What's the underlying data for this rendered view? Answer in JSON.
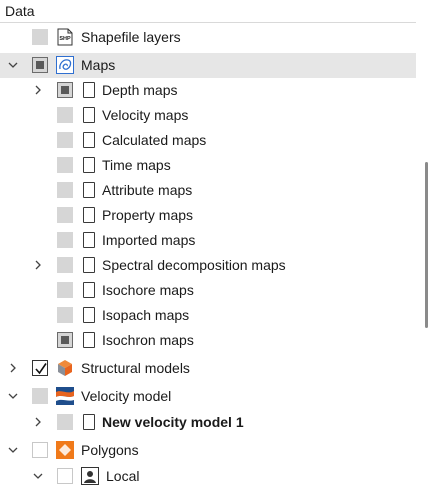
{
  "panel": {
    "title": "Data"
  },
  "tree": {
    "shapefile_layers": "Shapefile layers",
    "shp_badge": "SHP",
    "maps": "Maps",
    "depth_maps": "Depth maps",
    "velocity_maps": "Velocity maps",
    "calculated_maps": "Calculated maps",
    "time_maps": "Time maps",
    "attribute_maps": "Attribute maps",
    "property_maps": "Property maps",
    "imported_maps": "Imported maps",
    "spectral_maps": "Spectral decomposition maps",
    "isochore_maps": "Isochore maps",
    "isopach_maps": "Isopach maps",
    "isochron_maps": "Isochron maps",
    "structural_models": "Structural models",
    "velocity_model": "Velocity model",
    "new_velocity_model": "New velocity model 1",
    "polygons": "Polygons",
    "local": "Local"
  },
  "colors": {
    "selected_row": "#e6e6e6",
    "maps_icon": "#2f6fd0",
    "polygons_icon": "#f07a1a",
    "structural_icon": "#e8641e"
  },
  "icons": {
    "shapefile": "shp-file-icon",
    "maps": "map-contour-icon",
    "folder": "folder-icon",
    "structural": "cube-icon",
    "velocity": "velocity-model-icon",
    "polygons": "polygon-icon",
    "local": "user-icon"
  }
}
